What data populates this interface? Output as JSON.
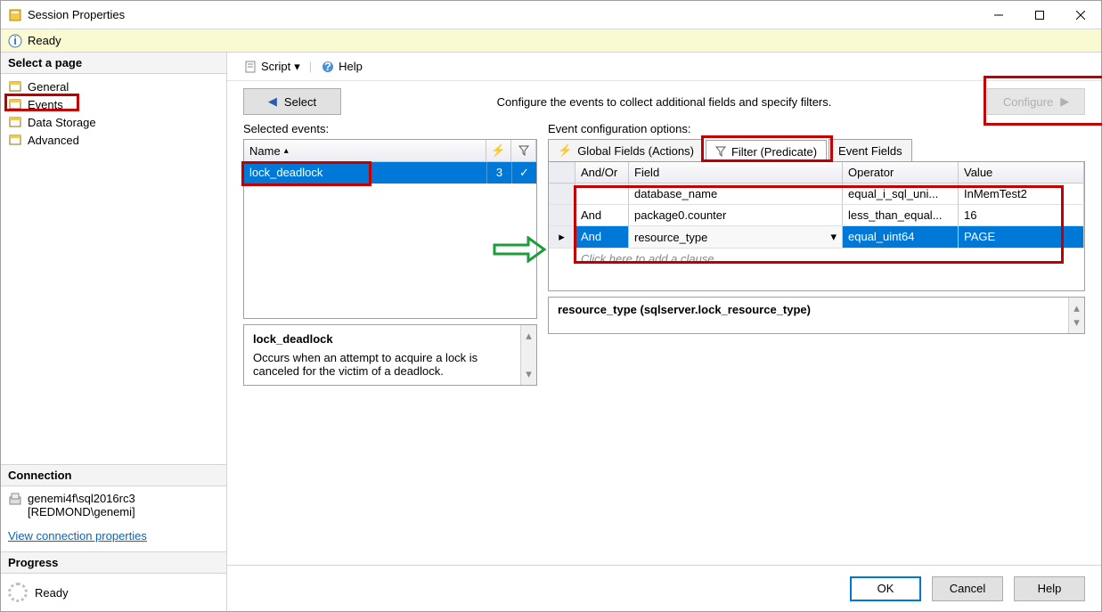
{
  "window": {
    "title": "Session Properties"
  },
  "status": {
    "text": "Ready"
  },
  "leftPane": {
    "selectPage": "Select a page",
    "pages": [
      "General",
      "Events",
      "Data Storage",
      "Advanced"
    ],
    "connection": {
      "title": "Connection",
      "server": "genemi4f\\sql2016rc3",
      "user": "[REDMOND\\genemi]",
      "link": "View connection properties"
    },
    "progress": {
      "title": "Progress",
      "text": "Ready"
    }
  },
  "toolbar": {
    "script": "Script",
    "help": "Help"
  },
  "navRow": {
    "select": "Select",
    "hint": "Configure the events to collect additional fields and specify filters.",
    "configure": "Configure"
  },
  "selectedEvents": {
    "label": "Selected events:",
    "header": "Name",
    "row": {
      "name": "lock_deadlock",
      "count": "3"
    },
    "desc": {
      "title": "lock_deadlock",
      "body": "Occurs when an attempt to acquire a lock is canceled for the victim of a deadlock."
    }
  },
  "configOptions": {
    "label": "Event configuration options:",
    "tabs": [
      "Global Fields (Actions)",
      "Filter (Predicate)",
      "Event Fields"
    ],
    "grid": {
      "headers": [
        "And/Or",
        "Field",
        "Operator",
        "Value"
      ],
      "rows": [
        {
          "andor": "",
          "field": "database_name",
          "op": "equal_i_sql_uni...",
          "val": "InMemTest2"
        },
        {
          "andor": "And",
          "field": "package0.counter",
          "op": "less_than_equal...",
          "val": "16"
        },
        {
          "andor": "And",
          "field": "resource_type",
          "op": "equal_uint64",
          "val": "PAGE"
        }
      ],
      "addClause": "Click here to add a clause"
    },
    "predInfo": "resource_type (sqlserver.lock_resource_type)"
  },
  "footer": {
    "ok": "OK",
    "cancel": "Cancel",
    "help": "Help"
  }
}
